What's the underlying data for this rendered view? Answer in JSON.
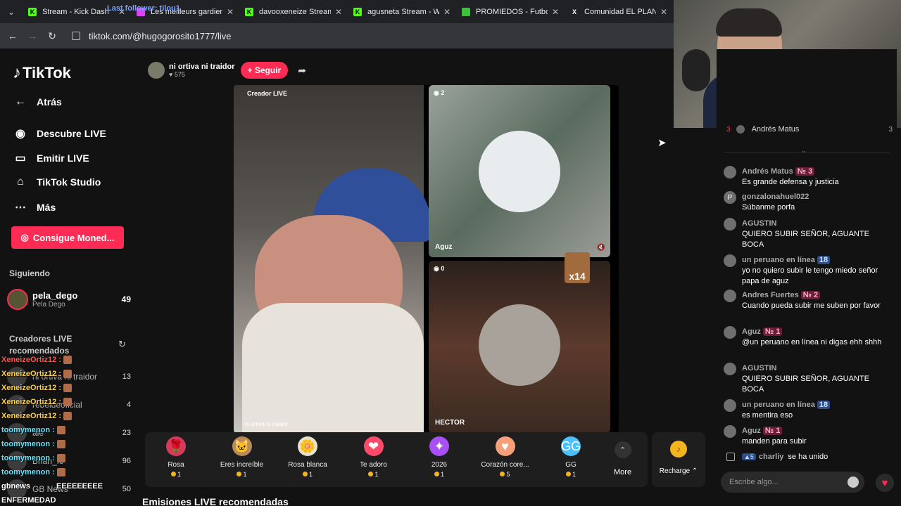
{
  "browser": {
    "tabs": [
      {
        "title": "Stream - Kick Dash",
        "icon": "kick-icon",
        "color": "#53fc18"
      },
      {
        "title": "Les meilleurs gardiens",
        "icon": "generic-icon",
        "color": "#e040fb"
      },
      {
        "title": "davooxeneize Stream",
        "icon": "kick-icon",
        "color": "#53fc18"
      },
      {
        "title": "agusneta Stream - Wa",
        "icon": "kick-icon",
        "color": "#53fc18"
      },
      {
        "title": "PROMIEDOS - Futbol A",
        "icon": "promiedos-icon",
        "color": "#3ec23e"
      },
      {
        "title": "Comunidad EL PLANET",
        "icon": "x-icon",
        "color": "#ffffff"
      }
    ],
    "tab_overlay_text": "Last follower: tilou1",
    "url": "tiktok.com/@hugogorosito1777/live"
  },
  "sidebar": {
    "logo": "TikTok",
    "nav": [
      {
        "label": "Atrás",
        "icon": "back-arrow-icon"
      },
      {
        "label": "Descubre LIVE",
        "icon": "live-discover-icon"
      },
      {
        "label": "Emitir LIVE",
        "icon": "camera-icon"
      },
      {
        "label": "TikTok Studio",
        "icon": "home-icon"
      },
      {
        "label": "Más",
        "icon": "more-dots-icon"
      }
    ],
    "cta": "Consigue Moned...",
    "following_label": "Siguiendo",
    "following": {
      "name": "pela_dego",
      "sub": "Pela Dego",
      "count": "49"
    },
    "creators_label": "Creadores LIVE recomendados",
    "creators": [
      {
        "name": "ni ortiva ni traidor",
        "count": "13"
      },
      {
        "name": "rebeldeoficial",
        "count": "4"
      },
      {
        "name": "ale",
        "count": "23"
      },
      {
        "name": "Brian_fc",
        "count": "96"
      },
      {
        "name": "GB News",
        "count": "50"
      }
    ]
  },
  "stream_chat_overlay": [
    {
      "user": "XeneizeOrtiz12 :",
      "color": "#ff5555"
    },
    {
      "user": "XeneizeOrtiz12 :",
      "color": "#ffd23f"
    },
    {
      "user": "XeneizeOrtiz12 :",
      "color": "#ffd23f"
    },
    {
      "user": "XeneizeOrtiz12 :",
      "color": "#ffd23f"
    },
    {
      "user": "XeneizeOrtiz12 :",
      "color": "#ffd23f"
    },
    {
      "user": "toomymenon :",
      "color": "#5ee8ff"
    },
    {
      "user": "toomymenon :",
      "color": "#5ee8ff"
    },
    {
      "user": "toomymenon :",
      "color": "#5ee8ff"
    },
    {
      "user": "toomymenon :",
      "color": "#5ee8ff"
    },
    {
      "user": "gbnews",
      "color": "#ffffff"
    },
    {
      "user": "ENFERMEDAD",
      "color": "#ffffff"
    }
  ],
  "overlay_extra": "EEEEEEEEE",
  "main": {
    "host_name": "ni ortiva ni traidor",
    "host_likes": "575",
    "follow_button": "+ Seguir",
    "creator_label": "Creador LIVE",
    "main_cam_footer": "ni ortiva ni traidor",
    "guest1": {
      "count": "2",
      "name": "Aguz"
    },
    "guest2": {
      "count": "0",
      "name": "HECTOR"
    },
    "gift_multiplier": "x14",
    "gifts": [
      {
        "name": "Rosa",
        "price": "1",
        "emoji": "🌹",
        "color": "#d43a5a"
      },
      {
        "name": "Eres increíble",
        "price": "1",
        "emoji": "🐱",
        "color": "#b88a5c"
      },
      {
        "name": "Rosa blanca",
        "price": "1",
        "emoji": "🌼",
        "color": "#e8e2cc"
      },
      {
        "name": "Te adoro",
        "price": "1",
        "emoji": "❤",
        "color": "#ff4a6a"
      },
      {
        "name": "2026",
        "price": "1",
        "emoji": "✦",
        "color": "#a84ff5"
      },
      {
        "name": "Corazón core...",
        "price": "5",
        "emoji": "♥",
        "color": "#f5a07a"
      },
      {
        "name": "GG",
        "price": "1",
        "emoji": "GG",
        "color": "#4ac0ff"
      }
    ],
    "more_label": "More",
    "recharge_label": "Recharge ⌃",
    "recommended_heading": "Emisiones LIVE recomendadas"
  },
  "chat": {
    "top_gifter": {
      "rank": "3",
      "name": "Andrés Matus",
      "value": "3"
    },
    "messages": [
      {
        "user": "Andrés Matus",
        "badge": "№ 3",
        "badge_type": "rank",
        "text": "Es grande defensa y justicia"
      },
      {
        "user": "gonzalonahuel022",
        "badge": "",
        "badge_type": "",
        "text": "Súbanme porfa",
        "initial": "P"
      },
      {
        "user": "AGUSTIN",
        "badge": "",
        "badge_type": "",
        "text": "QUIERO SUBIR SEÑOR, AGUANTE BOCA"
      },
      {
        "user": "un peruano en línea",
        "badge": "18",
        "badge_type": "level",
        "text": "yo no quiero subir le tengo miedo señor papa de aguz"
      },
      {
        "user": "Andres Fuertes",
        "badge": "№ 2",
        "badge_type": "rank",
        "text": "Cuando pueda subir me suben por favor"
      },
      {
        "user": "Aguz",
        "badge": "№ 1",
        "badge_type": "rank",
        "text": "@un peruano en línea ni digas ehh shhh"
      },
      {
        "user": "AGUSTIN",
        "badge": "",
        "badge_type": "",
        "text": "QUIERO SUBIR SEÑOR, AGUANTE BOCA"
      },
      {
        "user": "un peruano en línea",
        "badge": "18",
        "badge_type": "level",
        "text": "es mentira eso"
      },
      {
        "user": "Aguz",
        "badge": "№ 1",
        "badge_type": "rank",
        "text": "manden para subir"
      }
    ],
    "joined": {
      "level": "5",
      "user": "charliy",
      "text": "se ha unido"
    },
    "input_placeholder": "Escribe algo..."
  }
}
